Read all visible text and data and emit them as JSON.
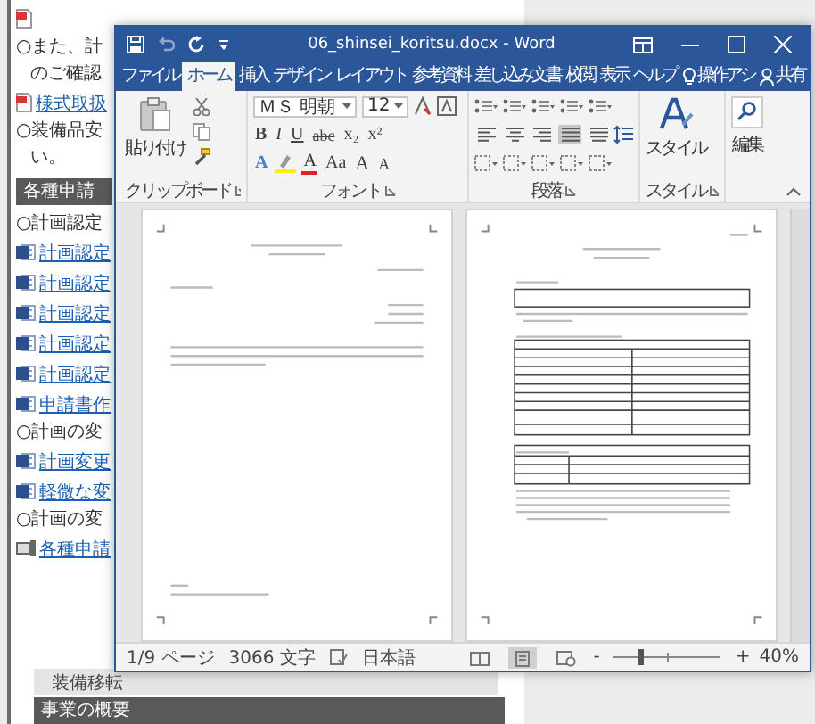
{
  "web_page": {
    "items": [
      {
        "kind": "pdf"
      },
      {
        "kind": "text",
        "text": "○また、計"
      },
      {
        "kind": "indent",
        "text": "のご確認"
      },
      {
        "kind": "pdf",
        "text": "様式取扱"
      },
      {
        "kind": "text",
        "text": "○装備品安"
      },
      {
        "kind": "indent",
        "text": "い。"
      },
      {
        "kind": "heading",
        "text": "各種申請"
      },
      {
        "kind": "text",
        "text": "○計画認定"
      },
      {
        "kind": "word",
        "text": "計画認定"
      },
      {
        "kind": "word",
        "text": "計画認定"
      },
      {
        "kind": "word",
        "text": "計画認定"
      },
      {
        "kind": "word",
        "text": "計画認定"
      },
      {
        "kind": "word",
        "text": "計画認定"
      },
      {
        "kind": "word",
        "text": "申請書作"
      },
      {
        "kind": "text",
        "text": "○計画の変"
      },
      {
        "kind": "word",
        "text": "計画変更"
      },
      {
        "kind": "word",
        "text": "軽微な変"
      },
      {
        "kind": "text",
        "text": "○計画の変"
      },
      {
        "kind": "doc",
        "text": "各種申請"
      }
    ],
    "footer": [
      {
        "kind": "band",
        "text": "装備移転"
      },
      {
        "kind": "heading",
        "text": "事業の概要"
      }
    ]
  },
  "word": {
    "title": "06_shinsei_koritsu.docx - Word",
    "tabs": [
      {
        "label": "ファイル",
        "selected": false
      },
      {
        "label": "ホーム",
        "selected": true
      },
      {
        "label": "挿入",
        "selected": false
      },
      {
        "label": "デザイン",
        "selected": false
      },
      {
        "label": "レイアウト",
        "selected": false
      },
      {
        "label": "参考資料",
        "selected": false
      },
      {
        "label": "差し込み文書",
        "selected": false
      },
      {
        "label": "校閲",
        "selected": false
      },
      {
        "label": "表示",
        "selected": false
      },
      {
        "label": "ヘルプ",
        "selected": false
      }
    ],
    "tell_me": "操作アシ",
    "share": "共有",
    "ribbon": {
      "clipboard": {
        "paste_label": "貼り付け",
        "group_label": "クリップボード"
      },
      "font": {
        "font_name": "ＭＳ 明朝",
        "font_size": "12",
        "format_buttons": [
          {
            "kind": "bold",
            "label": "B"
          },
          {
            "kind": "italic",
            "label": "I"
          },
          {
            "kind": "underline",
            "label": "U"
          },
          {
            "kind": "strike",
            "label": "abc"
          },
          {
            "kind": "sub",
            "label": "x₂"
          },
          {
            "kind": "sup",
            "label": "x²"
          }
        ],
        "effect_buttons": [
          {
            "kind": "effects",
            "label": "A"
          },
          {
            "kind": "highlight"
          },
          {
            "kind": "color",
            "label": "A"
          },
          {
            "kind": "case",
            "label": "Aa"
          },
          {
            "kind": "grow",
            "label": "A"
          },
          {
            "kind": "shrink",
            "label": "A"
          }
        ],
        "group_label": "フォント"
      },
      "paragraph": {
        "align_buttons": [
          {
            "kind": "left",
            "selected": false
          },
          {
            "kind": "center",
            "selected": false
          },
          {
            "kind": "right",
            "selected": false
          },
          {
            "kind": "justify",
            "selected": true
          },
          {
            "kind": "distributed",
            "selected": false
          }
        ],
        "group_label": "段落"
      },
      "styles": {
        "button_label": "スタイル",
        "group_label": "スタイル"
      },
      "editing": {
        "button_label": "編集"
      }
    },
    "status_bar": {
      "page": "1/9 ページ",
      "words": "3066 文字",
      "language": "日本語",
      "views": [
        {
          "kind": "read",
          "selected": false
        },
        {
          "kind": "print",
          "selected": true
        },
        {
          "kind": "web",
          "selected": false
        }
      ],
      "zoom_out": "-",
      "zoom_in": "+",
      "zoom": {
        "level": 0.25
      },
      "zoom_text": "40%"
    }
  }
}
